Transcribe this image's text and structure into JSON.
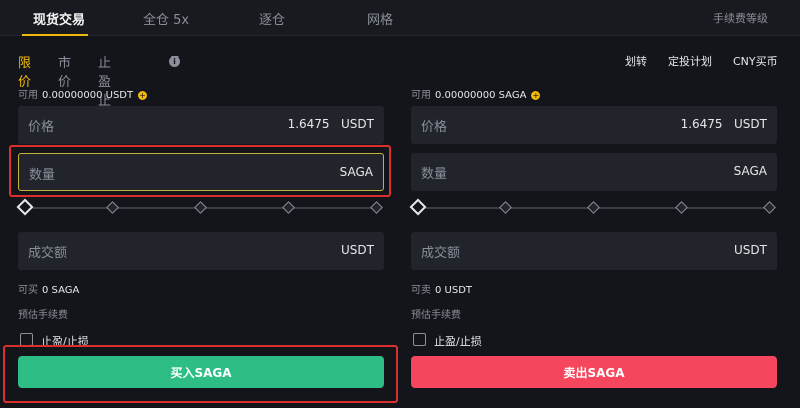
{
  "tabs": [
    {
      "label": "现货交易"
    },
    {
      "label": "全仓 5x"
    },
    {
      "label": "逐仓"
    },
    {
      "label": "网格"
    }
  ],
  "fee_level_link": "手续费等级",
  "order_types": [
    {
      "label": "限价"
    },
    {
      "label": "市价"
    },
    {
      "label": "止盈止损"
    }
  ],
  "links": {
    "transfer": "划转",
    "recurring": "定投计划",
    "cny_buy": "CNY买币"
  },
  "buy": {
    "available_label": "可用",
    "available_value": "0.00000000 USDT",
    "price_label": "价格",
    "price_value": "1.6475",
    "price_unit": "USDT",
    "amount_label": "数量",
    "amount_unit": "SAGA",
    "total_label": "成交额",
    "total_unit": "USDT",
    "max_label": "可买",
    "max_value": "0 SAGA",
    "fee_label": "预估手续费",
    "tpsl_label": "止盈/止损",
    "button_label": "买入SAGA"
  },
  "sell": {
    "available_label": "可用",
    "available_value": "0.00000000 SAGA",
    "price_label": "价格",
    "price_value": "1.6475",
    "price_unit": "USDT",
    "amount_label": "数量",
    "amount_unit": "SAGA",
    "total_label": "成交额",
    "total_unit": "USDT",
    "max_label": "可卖",
    "max_value": "0 USDT",
    "fee_label": "预估手续费",
    "tpsl_label": "止盈/止损",
    "button_label": "卖出SAGA"
  },
  "colors": {
    "accent": "#f0b90b",
    "buy": "#2ebd85",
    "sell": "#f6465d",
    "highlight": "#d9302d"
  }
}
